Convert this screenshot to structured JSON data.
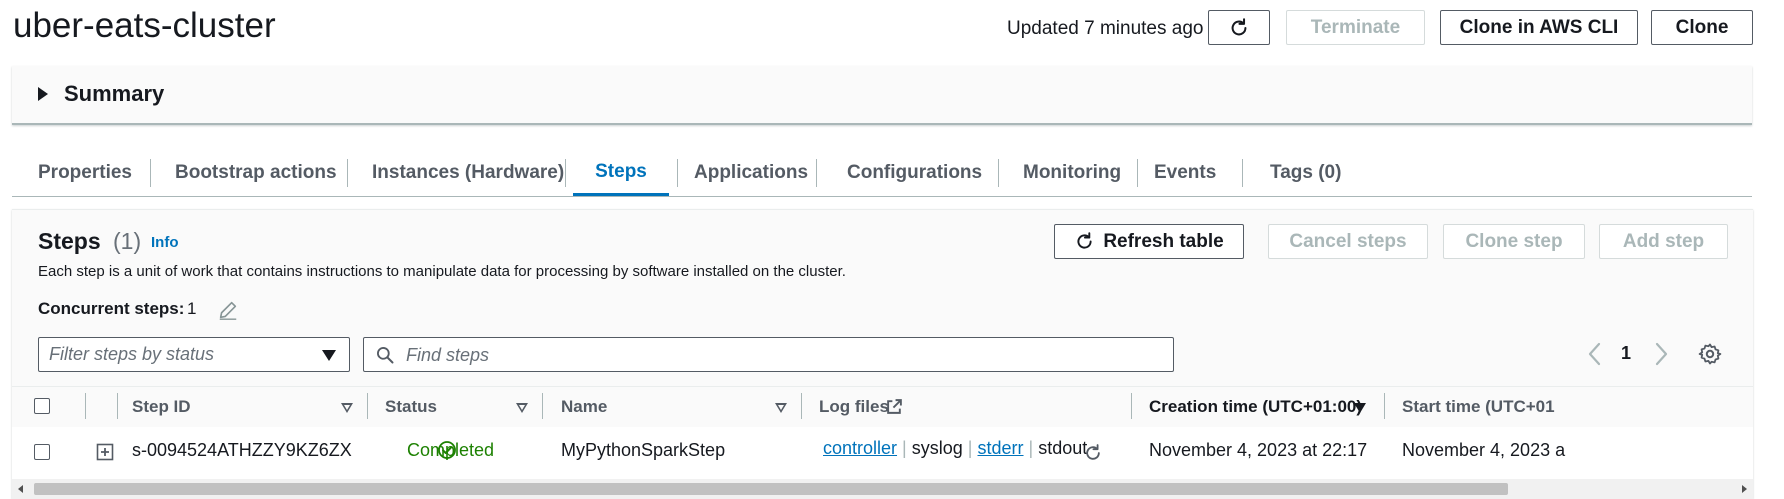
{
  "header": {
    "title": "uber-eats-cluster",
    "updated": "Updated 7 minutes ago",
    "refresh_icon": "refresh-icon",
    "terminate_label": "Terminate",
    "clone_cli_label": "Clone in AWS CLI",
    "clone_label": "Clone"
  },
  "summary": {
    "label": "Summary",
    "expanded": false
  },
  "tabs": [
    {
      "label": "Properties"
    },
    {
      "label": "Bootstrap actions"
    },
    {
      "label": "Instances (Hardware)"
    },
    {
      "label": "Steps",
      "active": true
    },
    {
      "label": "Applications"
    },
    {
      "label": "Configurations"
    },
    {
      "label": "Monitoring"
    },
    {
      "label": "Events"
    },
    {
      "label": "Tags (0)"
    }
  ],
  "steps_panel": {
    "title": "Steps",
    "count": "(1)",
    "info": "Info",
    "description": "Each step is a unit of work that contains instructions to manipulate data for processing by software installed on the cluster.",
    "refresh_table_label": "Refresh table",
    "cancel_steps_label": "Cancel steps",
    "clone_step_label": "Clone step",
    "add_step_label": "Add step",
    "concurrent_label": "Concurrent steps:",
    "concurrent_value": "1",
    "filter_placeholder": "Filter steps by status",
    "search_placeholder": "Find steps",
    "page": "1"
  },
  "table": {
    "columns": [
      "Step ID",
      "Status",
      "Name",
      "Log files",
      "Creation time (UTC+01:00)",
      "Start time (UTC+01"
    ],
    "rows": [
      {
        "step_id": "s-0094524ATHZZY9KZ6ZX",
        "status": "Completed",
        "name": "MyPythonSparkStep",
        "log_controller": "controller",
        "log_syslog": "syslog",
        "log_stderr": "stderr",
        "log_stdout": "stdout",
        "creation_time": "November 4, 2023 at 22:17",
        "start_time": "November 4, 2023 a"
      }
    ]
  },
  "colors": {
    "accent": "#0073bb",
    "success": "#1d8102",
    "disabled": "#aab7b8"
  }
}
